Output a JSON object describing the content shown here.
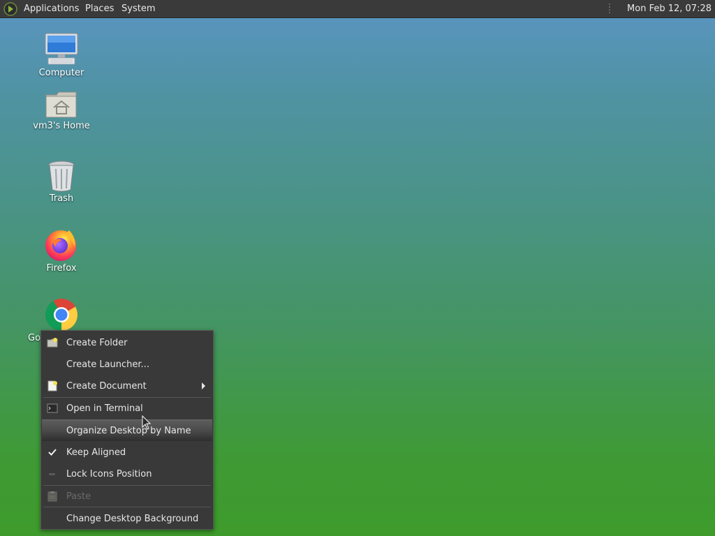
{
  "panel": {
    "applications": "Applications",
    "places": "Places",
    "system": "System",
    "clock": "Mon Feb 12, 07:28"
  },
  "desktop": {
    "icons": [
      {
        "label": "Computer",
        "icon": "computer-icon"
      },
      {
        "label": "vm3's Home",
        "icon": "home-folder-icon"
      },
      {
        "label": "Trash",
        "icon": "trash-icon"
      },
      {
        "label": "Firefox",
        "icon": "firefox-icon"
      },
      {
        "label": "Go",
        "icon": "chrome-icon"
      }
    ]
  },
  "context_menu": {
    "items": [
      {
        "label": "Create Folder",
        "icon": "folder-new-icon"
      },
      {
        "label": "Create Launcher...",
        "icon": ""
      },
      {
        "label": "Create Document",
        "icon": "document-new-icon",
        "submenu": true
      },
      {
        "label": "Open in Terminal",
        "icon": "terminal-icon"
      },
      {
        "label": "Organize Desktop by Name",
        "icon": "",
        "highlighted": true
      },
      {
        "label": "Keep Aligned",
        "icon": "check-icon",
        "checked": true
      },
      {
        "label": "Lock Icons Position",
        "icon": "toggle-off-icon"
      },
      {
        "label": "Paste",
        "icon": "clipboard-icon",
        "disabled": true
      },
      {
        "label": "Change Desktop Background",
        "icon": ""
      }
    ]
  },
  "colors": {
    "panel": "#3a3a3a",
    "menu": "#393939",
    "desktop_top": "#5b94c2",
    "desktop_bottom": "#3e9b2b"
  }
}
